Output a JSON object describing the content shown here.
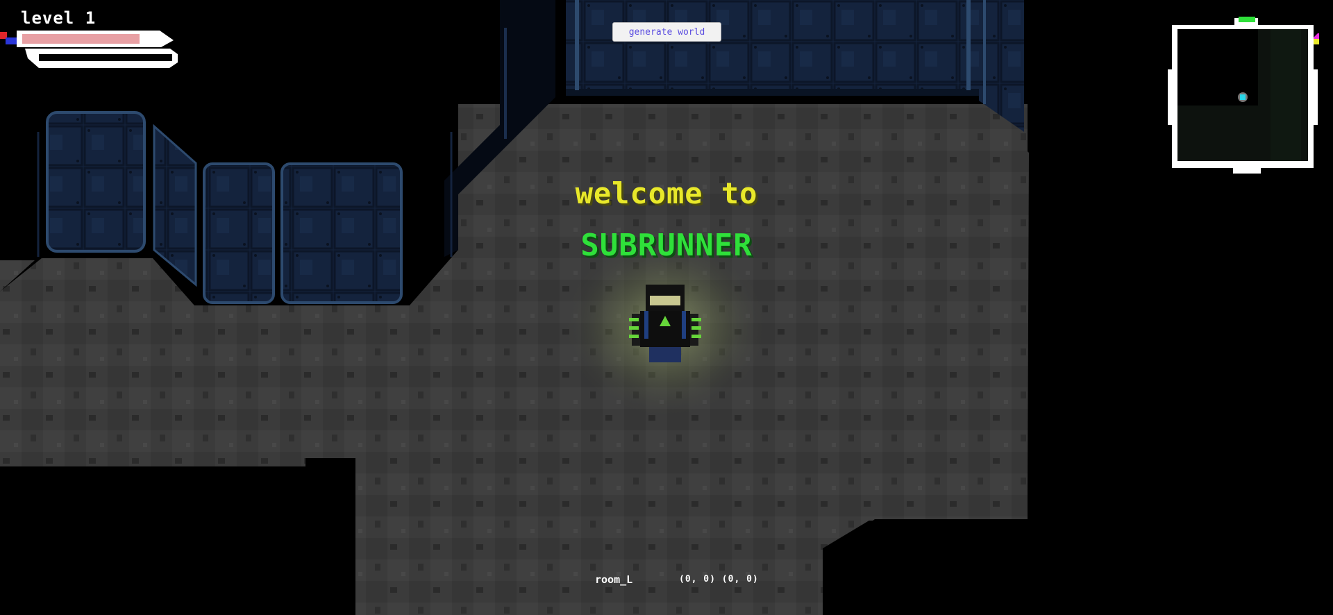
{
  "hud": {
    "level_label": "level 1",
    "health_fraction": 0.88,
    "health_color": "#e8a0a4"
  },
  "toolbar": {
    "generate_label": "generate world"
  },
  "banner": {
    "welcome": "welcome to",
    "title": "SUBRUNNER"
  },
  "status": {
    "room": "room_L",
    "coords": "(0, 0) (0, 0)"
  },
  "colors": {
    "floor": "#3a3a3a",
    "wall": "#14233d",
    "wall_trim": "#2d4a6e",
    "accent_green": "#2fe03a",
    "accent_yellow": "#e8e82a",
    "player_glow": "#7d8a55",
    "minimap_bg": "#0d120e",
    "minimap_player": "#29d6e8"
  },
  "icons": {
    "player": "player-sprite-icon",
    "minimap_player": "minimap-player-icon"
  }
}
